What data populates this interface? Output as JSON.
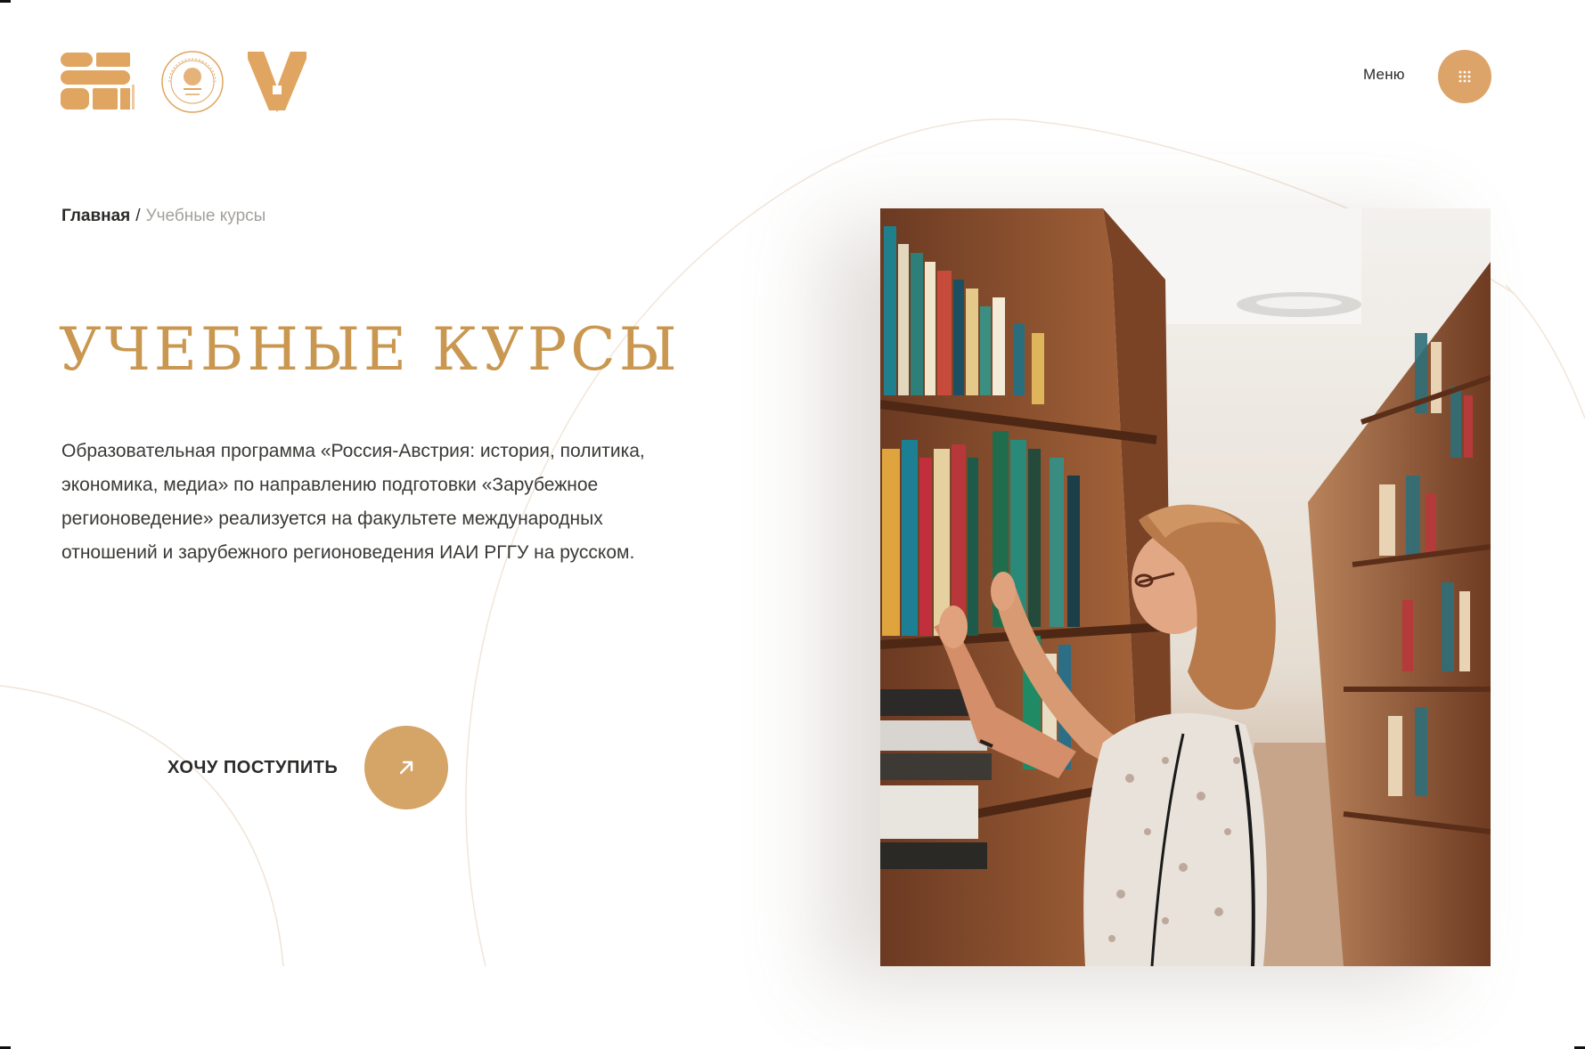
{
  "header": {
    "logos": [
      {
        "name": "program-logo",
        "color": "#e0a561"
      },
      {
        "name": "rggu-seal-logo",
        "color": "#e0a561"
      },
      {
        "name": "institute-a-logo",
        "color": "#e0a561"
      }
    ],
    "menu_label": "Меню",
    "menu_icon": "grid-dots-icon"
  },
  "breadcrumb": {
    "home": "Главная",
    "separator": "/",
    "current": "Учебные курсы"
  },
  "main": {
    "title": "УЧЕБНЫЕ КУРСЫ",
    "description": "Образовательная программа «Россия-Австрия: история, политика, экономика, медиа» по направлению подготовки «Зарубежное регионоведение» реализуется на факультете международных отношений и зарубежного регионоведения ИАИ РГГУ на русском.",
    "cta_label": "ХОЧУ ПОСТУПИТЬ",
    "cta_icon": "arrow-up-right-icon"
  },
  "colors": {
    "accent": "#dda46a",
    "title": "#c9974f",
    "text": "#2b2a28",
    "muted": "#a3a19d"
  }
}
